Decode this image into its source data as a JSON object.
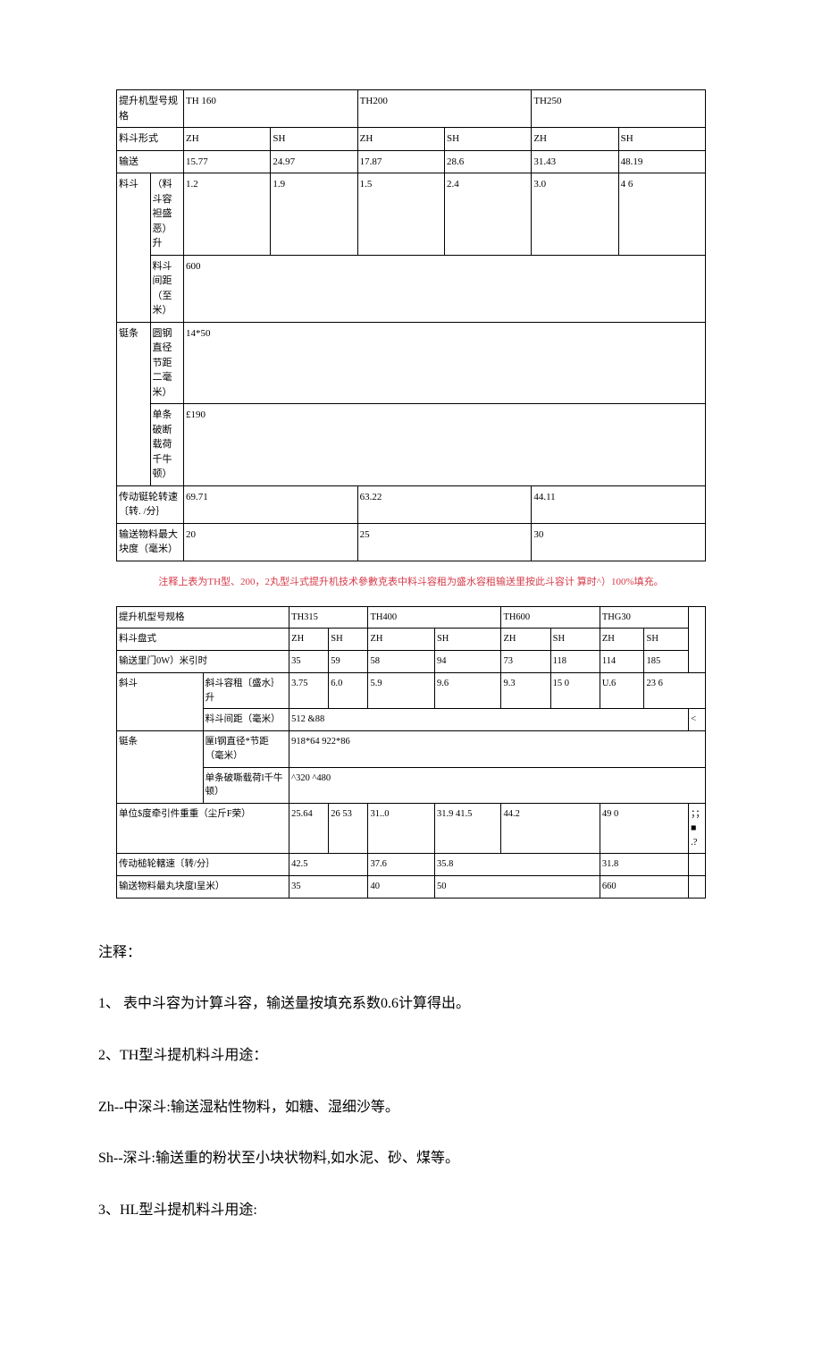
{
  "table1": {
    "rows": {
      "model_label": "提升机型号规格",
      "model": [
        "TH 160",
        "TH200",
        "TH250"
      ],
      "bucket_type_label": "料斗形式",
      "bucket_type": [
        "ZH",
        "SH",
        "ZH",
        "SH",
        "ZH",
        "SH"
      ],
      "convey_label": "输送",
      "convey": [
        "15.77",
        "24.97",
        "17.87",
        "28.6",
        "31.43",
        "48.19"
      ],
      "bucket_label": "料斗",
      "bucket_cap_label": "（料斗容袒盛恶）升",
      "bucket_cap": [
        "1.2",
        "1.9",
        "1.5",
        "2.4",
        "3.0",
        "4 6"
      ],
      "bucket_spacing_label": "料斗间距（至米）",
      "bucket_spacing": "600",
      "chain_label": "铤条",
      "chain_diam_label": "圆钢直径节距二毫米）",
      "chain_diam": "14*50",
      "chain_break_label": "单条破断载荷千牛顿）",
      "chain_break": "£190",
      "drive_speed_label": "传动铤轮转速〔转. /分｝",
      "drive_speed": [
        "69.71",
        "63.22",
        "44.11"
      ],
      "max_lump_label": "输送物料最大块度（毫米）",
      "max_lump": [
        "20",
        "25",
        "30"
      ]
    }
  },
  "note_red": "注释上表为TH型、200，2丸型斗式提升机技术參數克表中料斗容租为盛水容租输送里按此斗容计  算时^）100%填充。",
  "table2": {
    "rows": {
      "model_label": "提升机型号规格",
      "model": [
        "TH315",
        "TH400",
        "TH600",
        "THG30"
      ],
      "bucket_type_label": "料斗盘式",
      "bucket_type": [
        "ZH",
        "SH",
        "ZH",
        "SH",
        "ZH",
        "SH",
        "ZH",
        "SH"
      ],
      "convey_label": "输送里门0W）米引时",
      "convey": [
        "35",
        "59",
        "58",
        "94",
        "73",
        "118",
        "114",
        "185"
      ],
      "tilt_label": "斜斗",
      "tilt_cap_label": "斜斗容租〔盛水｝升",
      "tilt_cap": [
        "3.75",
        "6.0",
        "5.9",
        "9.6",
        "9.3",
        "15 0",
        "U.6",
        "23 6"
      ],
      "spacing_label": "料斗间距（毫米）",
      "spacing": "512 &88",
      "spacing_tail": "<",
      "chain_label": "铤条",
      "chain_diam_label": "匰l钢直径*节距（毫米）",
      "chain_diam": "918*64 922*86",
      "chain_break_label": "单条破嘶载荷l千牛顿）",
      "chain_break": "^320     ^480",
      "unit_weight_label": "单位$度牵引件重重（尘斤F荣）",
      "unit_weight": [
        "25.64",
        "26 53",
        "31..0",
        "31.9 41.5",
        "44.2",
        "49 0",
        "；；■ .?"
      ],
      "drive_speed_label": "传动槌轮轄速〔转/分｝",
      "drive_speed": [
        "42.5",
        "37.6",
        "35.8",
        "31.8"
      ],
      "max_lump_label": "输送物料最丸块度l呈米）",
      "max_lump": [
        "35",
        "40",
        "50",
        "660"
      ]
    }
  },
  "notes": {
    "heading": "注释：",
    "n1": "1、  表中斗容为计算斗容，输送量按填充系数0.6计算得出。",
    "n2": "2、TH型斗提机料斗用途：",
    "zh": "Zh--中深斗:输送湿粘性物料，如糖、湿细沙等。",
    "sh": " Sh--深斗:输送重的粉状至小块状物料,如水泥、砂、煤等。",
    "n3": "3、HL型斗提机料斗用途:"
  }
}
